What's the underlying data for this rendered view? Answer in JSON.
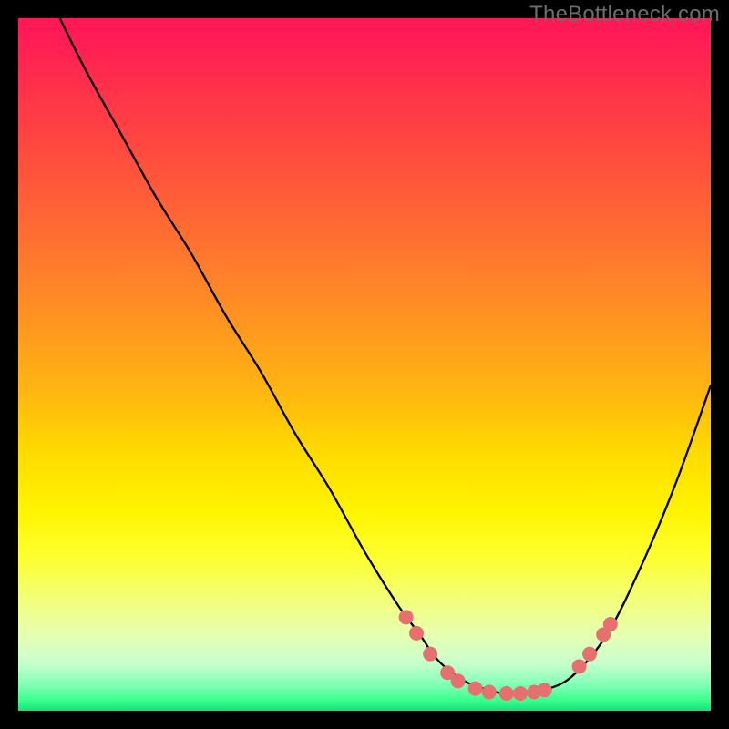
{
  "watermark": "TheBottleneck.com",
  "chart_data": {
    "type": "line",
    "title": "",
    "xlabel": "",
    "ylabel": "",
    "xlim": [
      0,
      100
    ],
    "ylim": [
      0,
      100
    ],
    "series": [
      {
        "name": "curve",
        "x": [
          6,
          10,
          15,
          20,
          25,
          30,
          35,
          40,
          45,
          50,
          55,
          58,
          60,
          62,
          65,
          68,
          70,
          73,
          76,
          80,
          85,
          90,
          95,
          100
        ],
        "y": [
          100,
          92,
          83,
          74,
          66,
          57,
          49,
          40,
          32,
          23,
          15,
          11,
          8,
          6,
          4,
          3,
          2.5,
          2.5,
          3,
          5,
          11,
          21,
          33,
          47
        ]
      }
    ],
    "markers": [
      {
        "x": 56,
        "y": 13.5
      },
      {
        "x": 57.5,
        "y": 11.2
      },
      {
        "x": 59.5,
        "y": 8.2
      },
      {
        "x": 62,
        "y": 5.5
      },
      {
        "x": 63.5,
        "y": 4.3
      },
      {
        "x": 66,
        "y": 3.2
      },
      {
        "x": 68,
        "y": 2.7
      },
      {
        "x": 70.5,
        "y": 2.5
      },
      {
        "x": 72.5,
        "y": 2.5
      },
      {
        "x": 74.5,
        "y": 2.7
      },
      {
        "x": 76,
        "y": 3.0
      },
      {
        "x": 81,
        "y": 6.4
      },
      {
        "x": 82.5,
        "y": 8.2
      },
      {
        "x": 84.5,
        "y": 11.0
      },
      {
        "x": 85.5,
        "y": 12.5
      }
    ]
  }
}
